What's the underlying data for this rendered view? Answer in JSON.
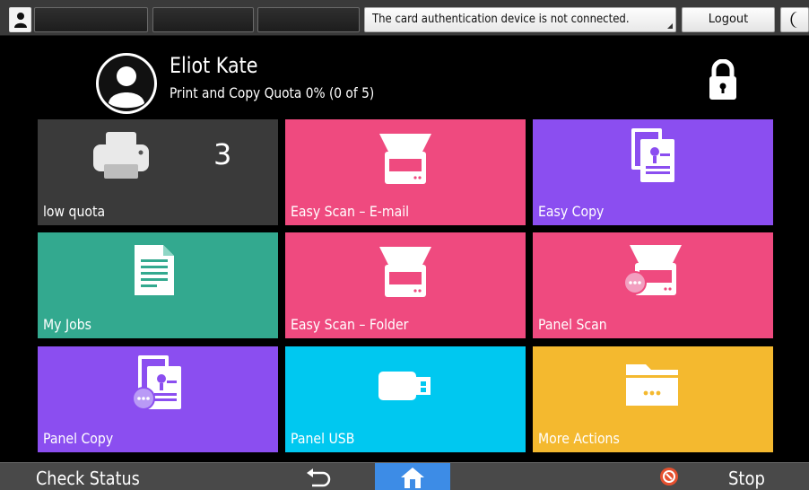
{
  "topbar": {
    "user_icon": "user-icon",
    "message": "The card authentication device is not connected.",
    "logout_label": "Logout",
    "moon_icon": "moon-icon"
  },
  "user": {
    "name": "Eliot Kate",
    "quota": "Print and Copy Quota  0% (0 of 5)",
    "lock_icon": "lock-icon"
  },
  "tiles": [
    {
      "label": "low quota",
      "icon": "printer-icon",
      "count": "3",
      "color": "#3a3a3a"
    },
    {
      "label": "Easy Scan – E-mail",
      "icon": "scanner-icon",
      "color": "#ef4a7f"
    },
    {
      "label": "Easy Copy",
      "icon": "copy-document-icon",
      "color": "#8b4ef0"
    },
    {
      "label": "My Jobs",
      "icon": "document-icon",
      "color": "#33a98f"
    },
    {
      "label": "Easy Scan – Folder",
      "icon": "scanner-icon",
      "color": "#ef4a7f"
    },
    {
      "label": "Panel Scan",
      "icon": "panel-scanner-icon",
      "color": "#ef4a7f"
    },
    {
      "label": "Panel Copy",
      "icon": "panel-copy-icon",
      "color": "#8b4ef0"
    },
    {
      "label": "Panel USB",
      "icon": "usb-icon",
      "color": "#00c8f0"
    },
    {
      "label": "More Actions",
      "icon": "folder-more-icon",
      "color": "#f4b92f"
    }
  ],
  "bottombar": {
    "check_status_label": "Check Status",
    "back_icon": "back-icon",
    "home_icon": "home-icon",
    "stop_icon": "stop-icon",
    "stop_label": "Stop"
  }
}
